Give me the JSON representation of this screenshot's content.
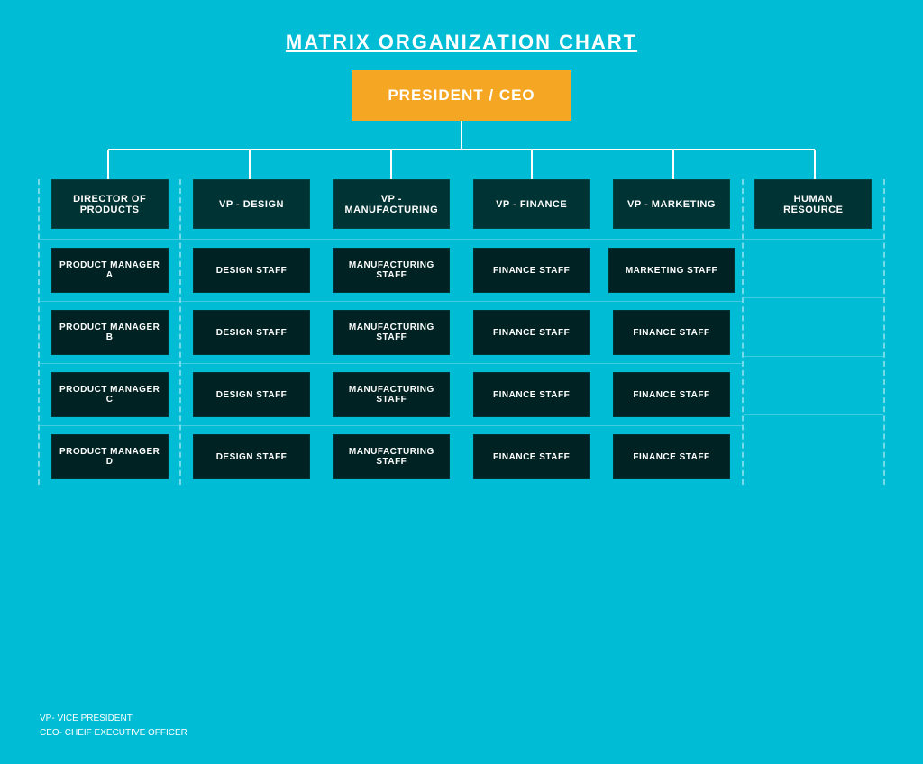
{
  "title": "MATRIX ORGANIZATION CHART",
  "ceo": "PRESIDENT / CEO",
  "columns": [
    {
      "id": "director",
      "header": "DIRECTOR OF PRODUCTS",
      "staff": [
        "PRODUCT MANAGER A",
        "PRODUCT MANAGER B",
        "PRODUCT MANAGER C",
        "PRODUCT MANAGER D"
      ],
      "is_pm": true
    },
    {
      "id": "vp_design",
      "header": "VP - DESIGN",
      "staff": [
        "DESIGN STAFF",
        "DESIGN STAFF",
        "DESIGN STAFF",
        "DESIGN STAFF"
      ],
      "is_pm": false
    },
    {
      "id": "vp_manufacturing",
      "header": "VP - MANUFACTURING",
      "staff": [
        "MANUFACTURING STAFF",
        "MANUFACTURING STAFF",
        "MANUFACTURING STAFF",
        "MANUFACTURING STAFF"
      ],
      "is_pm": false
    },
    {
      "id": "vp_finance",
      "header": "VP - FINANCE",
      "staff": [
        "FINANCE STAFF",
        "FINANCE STAFF",
        "FINANCE STAFF",
        "FINANCE STAFF"
      ],
      "is_pm": false
    },
    {
      "id": "vp_marketing",
      "header": "VP - MARKETING",
      "staff": [
        "MARKETING STAFF",
        "FINANCE STAFF",
        "FINANCE STAFF",
        "FINANCE STAFF"
      ],
      "is_pm": false
    },
    {
      "id": "hr",
      "header": "HUMAN RESOURCE",
      "staff": [],
      "is_hr": true
    }
  ],
  "footnote_lines": [
    "VP- VICE PRESIDENT",
    "CEO- CHEIF EXECUTIVE OFFICER"
  ]
}
